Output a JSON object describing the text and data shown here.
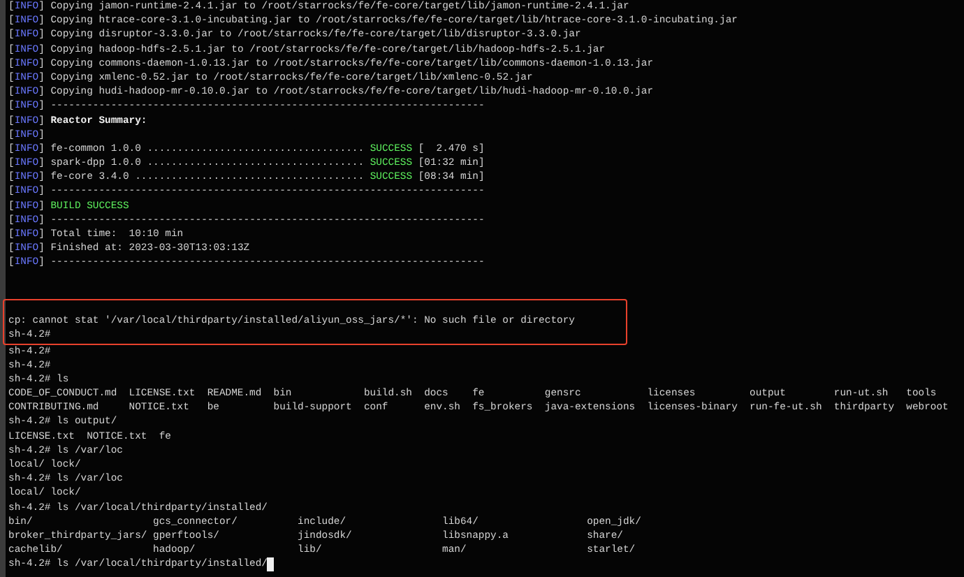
{
  "terminal": {
    "lines": [
      {
        "kind": "info",
        "tag": "[INFO]",
        "parts": [
          {
            "kind": "plain",
            "text": "Copying jamon-runtime-2.4.1.jar to /root/starrocks/fe/fe-core/target/lib/jamon-runtime-2.4.1.jar"
          }
        ]
      },
      {
        "kind": "info",
        "tag": "[INFO]",
        "parts": [
          {
            "kind": "plain",
            "text": "Copying htrace-core-3.1.0-incubating.jar to /root/starrocks/fe/fe-core/target/lib/htrace-core-3.1.0-incubating.jar"
          }
        ]
      },
      {
        "kind": "info",
        "tag": "[INFO]",
        "parts": [
          {
            "kind": "plain",
            "text": "Copying disruptor-3.3.0.jar to /root/starrocks/fe/fe-core/target/lib/disruptor-3.3.0.jar"
          }
        ]
      },
      {
        "kind": "info",
        "tag": "[INFO]",
        "parts": [
          {
            "kind": "plain",
            "text": "Copying hadoop-hdfs-2.5.1.jar to /root/starrocks/fe/fe-core/target/lib/hadoop-hdfs-2.5.1.jar"
          }
        ]
      },
      {
        "kind": "info",
        "tag": "[INFO]",
        "parts": [
          {
            "kind": "plain",
            "text": "Copying commons-daemon-1.0.13.jar to /root/starrocks/fe/fe-core/target/lib/commons-daemon-1.0.13.jar"
          }
        ]
      },
      {
        "kind": "info",
        "tag": "[INFO]",
        "parts": [
          {
            "kind": "plain",
            "text": "Copying xmlenc-0.52.jar to /root/starrocks/fe/fe-core/target/lib/xmlenc-0.52.jar"
          }
        ]
      },
      {
        "kind": "info",
        "tag": "[INFO]",
        "parts": [
          {
            "kind": "plain",
            "text": "Copying hudi-hadoop-mr-0.10.0.jar to /root/starrocks/fe/fe-core/target/lib/hudi-hadoop-mr-0.10.0.jar"
          }
        ]
      },
      {
        "kind": "info",
        "tag": "[INFO]",
        "parts": [
          {
            "kind": "plain",
            "text": "------------------------------------------------------------------------"
          }
        ]
      },
      {
        "kind": "info",
        "tag": "[INFO]",
        "parts": [
          {
            "kind": "bold",
            "text": "Reactor Summary:"
          }
        ]
      },
      {
        "kind": "info",
        "tag": "[INFO]"
      },
      {
        "kind": "info",
        "tag": "[INFO]",
        "parts": [
          {
            "kind": "plain",
            "text": "fe-common 1.0.0 .................................... "
          },
          {
            "kind": "success",
            "text": "SUCCESS"
          },
          {
            "kind": "plain",
            "text": " [  2.470 s]"
          }
        ]
      },
      {
        "kind": "info",
        "tag": "[INFO]",
        "parts": [
          {
            "kind": "plain",
            "text": "spark-dpp 1.0.0 .................................... "
          },
          {
            "kind": "success",
            "text": "SUCCESS"
          },
          {
            "kind": "plain",
            "text": " [01:32 min]"
          }
        ]
      },
      {
        "kind": "info",
        "tag": "[INFO]",
        "parts": [
          {
            "kind": "plain",
            "text": "fe-core 3.4.0 ...................................... "
          },
          {
            "kind": "success",
            "text": "SUCCESS"
          },
          {
            "kind": "plain",
            "text": " [08:34 min]"
          }
        ]
      },
      {
        "kind": "info",
        "tag": "[INFO]",
        "parts": [
          {
            "kind": "plain",
            "text": "------------------------------------------------------------------------"
          }
        ]
      },
      {
        "kind": "info",
        "tag": "[INFO]",
        "parts": [
          {
            "kind": "success",
            "text": "BUILD SUCCESS"
          }
        ]
      },
      {
        "kind": "info",
        "tag": "[INFO]",
        "parts": [
          {
            "kind": "plain",
            "text": "------------------------------------------------------------------------"
          }
        ]
      },
      {
        "kind": "info",
        "tag": "[INFO]",
        "parts": [
          {
            "kind": "plain",
            "text": "Total time:  10:10 min"
          }
        ]
      },
      {
        "kind": "info",
        "tag": "[INFO]",
        "parts": [
          {
            "kind": "plain",
            "text": "Finished at: 2023-03-30T13:03:13Z"
          }
        ]
      },
      {
        "kind": "info",
        "tag": "[INFO]",
        "parts": [
          {
            "kind": "plain",
            "text": "------------------------------------------------------------------------"
          }
        ]
      },
      {
        "kind": "blank"
      },
      {
        "kind": "blank"
      },
      {
        "kind": "highlight",
        "lines": [
          {
            "kind": "blank"
          },
          {
            "kind": "output",
            "text": "cp: cannot stat '/var/local/thirdparty/installed/aliyun_oss_jars/*': No such file or directory"
          },
          {
            "kind": "shell",
            "text": "sh-4.2#",
            "cursor": false
          }
        ]
      },
      {
        "kind": "shell",
        "text": "sh-4.2#",
        "cursor": false
      },
      {
        "kind": "shell",
        "text": "sh-4.2#",
        "cursor": false
      },
      {
        "kind": "shell",
        "text": "sh-4.2# ls",
        "cursor": false
      },
      {
        "kind": "output",
        "text": "CODE_OF_CONDUCT.md  LICENSE.txt  README.md  bin            build.sh  docs    fe          gensrc           licenses         output        run-ut.sh   tools"
      },
      {
        "kind": "output",
        "text": "CONTRIBUTING.md     NOTICE.txt   be         build-support  conf      env.sh  fs_brokers  java-extensions  licenses-binary  run-fe-ut.sh  thirdparty  webroot"
      },
      {
        "kind": "shell",
        "text": "sh-4.2# ls output/",
        "cursor": false
      },
      {
        "kind": "output",
        "text": "LICENSE.txt  NOTICE.txt  fe"
      },
      {
        "kind": "shell",
        "text": "sh-4.2# ls /var/loc",
        "cursor": false
      },
      {
        "kind": "output",
        "text": "local/ lock/"
      },
      {
        "kind": "shell",
        "text": "sh-4.2# ls /var/loc",
        "cursor": false
      },
      {
        "kind": "output",
        "text": "local/ lock/"
      },
      {
        "kind": "shell",
        "text": "sh-4.2# ls /var/local/thirdparty/installed/",
        "cursor": false
      },
      {
        "kind": "output",
        "text": "bin/                    gcs_connector/          include/                lib64/                  open_jdk/"
      },
      {
        "kind": "output",
        "text": "broker_thirdparty_jars/ gperftools/             jindosdk/               libsnappy.a             share/"
      },
      {
        "kind": "output",
        "text": "cachelib/               hadoop/                 lib/                    man/                    starlet/"
      },
      {
        "kind": "shell",
        "text": "sh-4.2# ls /var/local/thirdparty/installed/",
        "cursor": true
      }
    ]
  }
}
